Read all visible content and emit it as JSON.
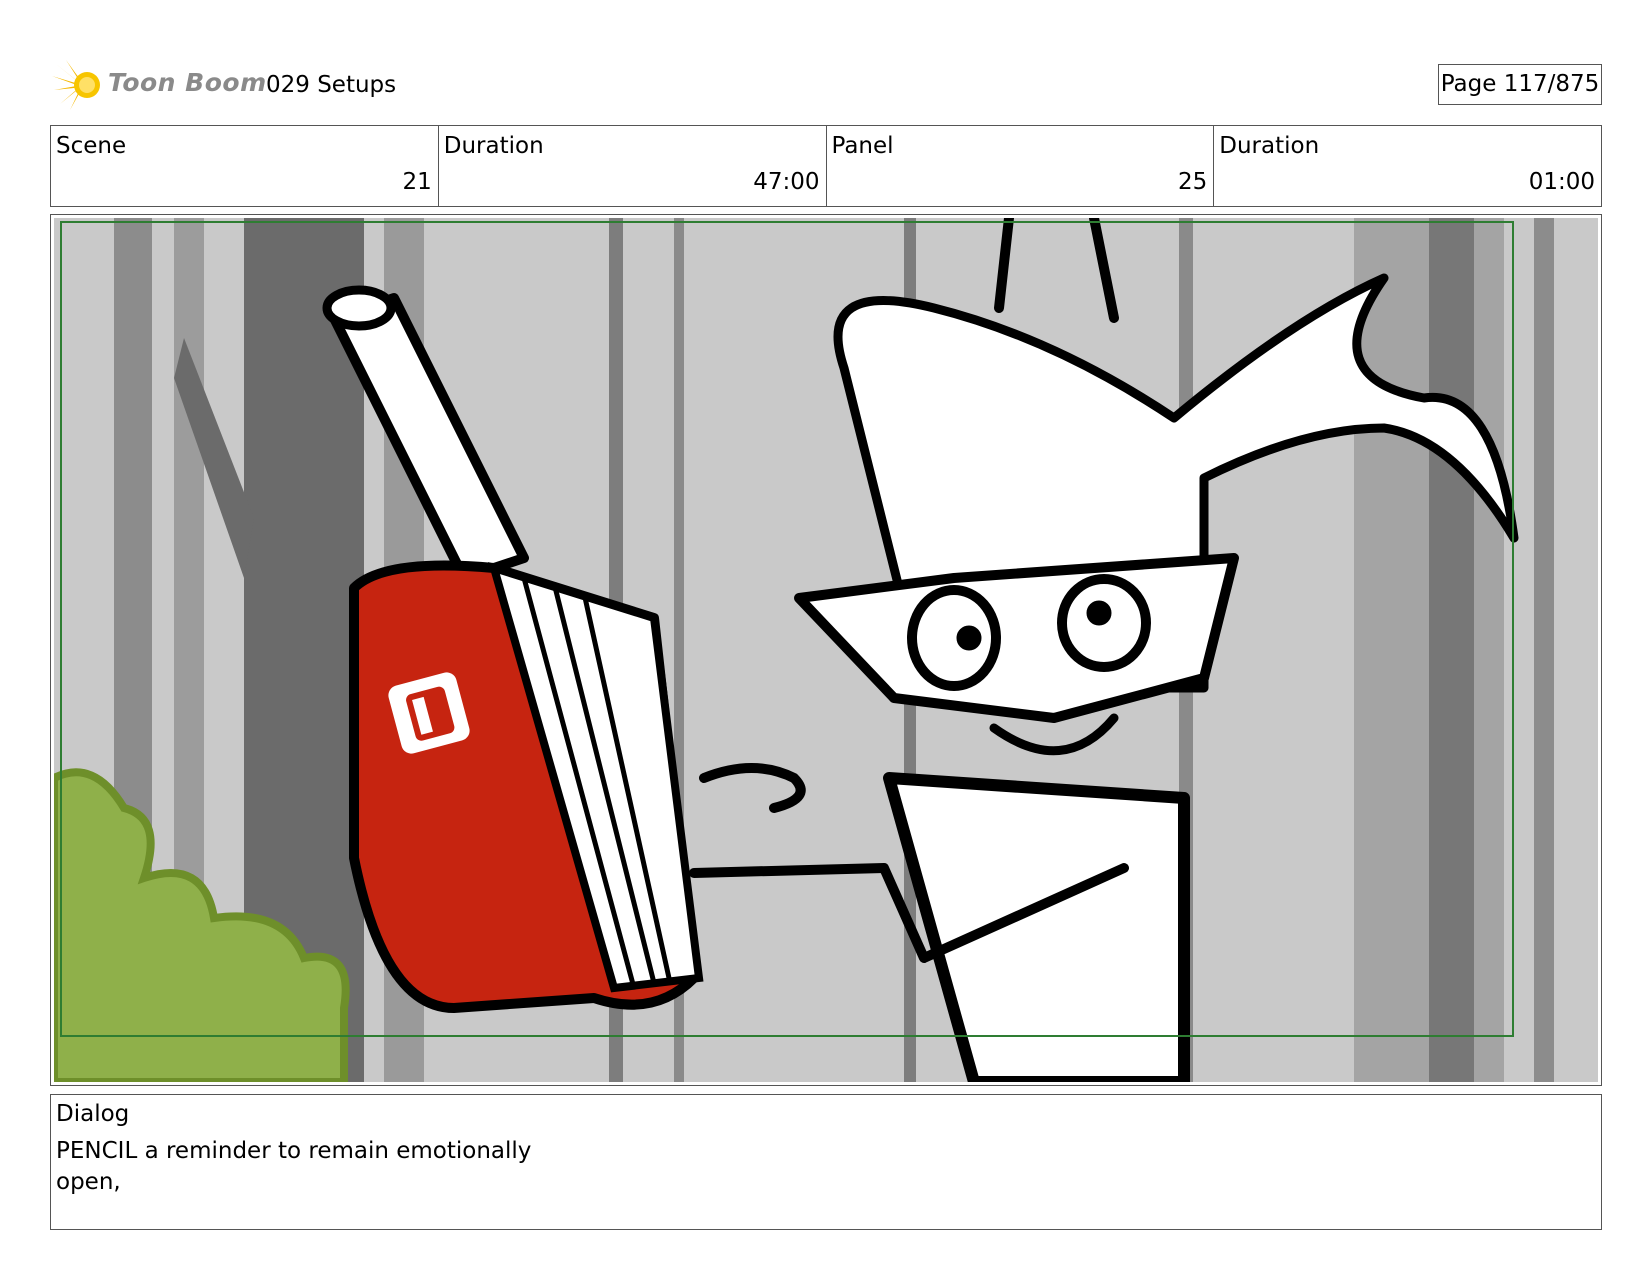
{
  "header": {
    "logo_text": "Toon Boom",
    "project_title": "029 Setups",
    "page_indicator": "Page 117/875"
  },
  "info": {
    "scene_label": "Scene",
    "scene_value": "21",
    "scene_duration_label": "Duration",
    "scene_duration_value": "47:00",
    "panel_label": "Panel",
    "panel_value": "25",
    "panel_duration_label": "Duration",
    "panel_duration_value": "01:00"
  },
  "panel": {
    "border_color": "#2e7d32",
    "book_color": "#c62410",
    "bush_color": "#8fb04a",
    "background_color": "#c8c8c8",
    "book_logo_icon": "book-logo-icon"
  },
  "dialog": {
    "label": "Dialog",
    "text": "PENCIL  a reminder to remain emotionally\nopen,"
  }
}
